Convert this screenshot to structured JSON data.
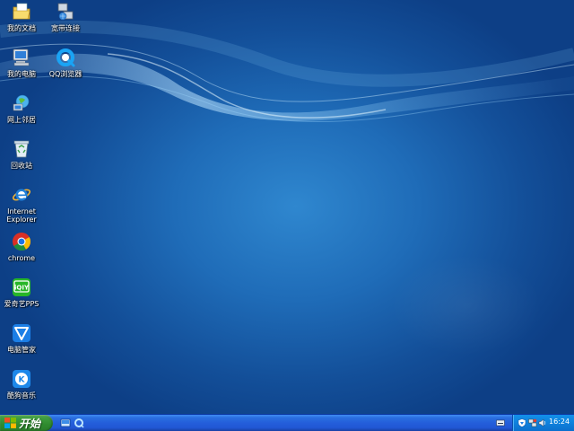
{
  "desktop": {
    "icons": [
      {
        "label": "我的文档",
        "icon": "my-documents-icon"
      },
      {
        "label": "宽带连接",
        "icon": "broadband-connection-icon"
      },
      {
        "label": "我的电脑",
        "icon": "my-computer-icon"
      },
      {
        "label": "QQ浏览器",
        "icon": "qq-browser-icon"
      },
      {
        "label": "网上邻居",
        "icon": "network-places-icon"
      },
      {
        "label": "回收站",
        "icon": "recycle-bin-icon"
      },
      {
        "label": "Internet\nExplorer",
        "icon": "internet-explorer-icon"
      },
      {
        "label": "chrome",
        "icon": "chrome-icon"
      },
      {
        "label": "爱奇艺PPS",
        "icon": "iqiyi-pps-icon"
      },
      {
        "label": "电脑管家",
        "icon": "pc-manager-icon"
      },
      {
        "label": "酷狗音乐",
        "icon": "kugou-music-icon"
      }
    ]
  },
  "taskbar": {
    "start_label": "开始",
    "clock": "16:24",
    "colors": {
      "taskbar": "#245edb",
      "start": "#3c9a3c",
      "tray": "#0f83de"
    }
  }
}
